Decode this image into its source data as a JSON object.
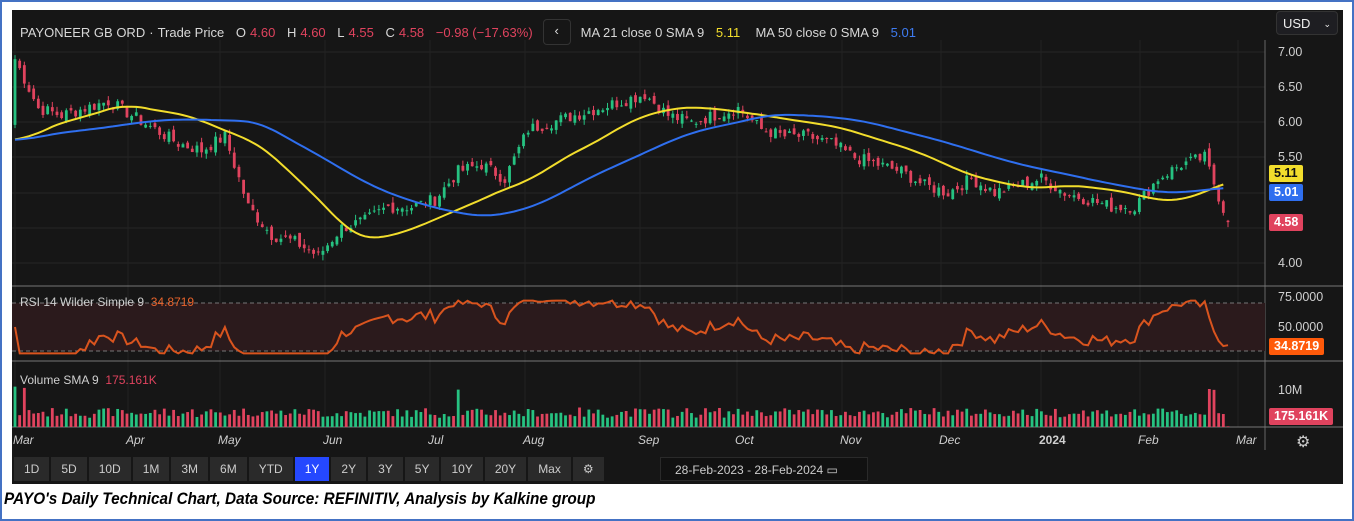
{
  "header": {
    "symbol": "PAYONEER GB ORD",
    "sep": "·",
    "price_type": "Trade Price",
    "o_label": "O",
    "o": "4.60",
    "h_label": "H",
    "h": "4.60",
    "l_label": "L",
    "l": "4.55",
    "c_label": "C",
    "c": "4.58",
    "change": "−0.98 (−17.63%)",
    "back": "‹",
    "ma21_label": "MA 21 close 0 SMA 9",
    "ma21": "5.11",
    "ma50_label": "MA 50 close 0 SMA 9",
    "ma50": "5.01"
  },
  "currency": "USD",
  "price_axis": [
    "7.00",
    "6.50",
    "6.00",
    "5.50",
    "4.00"
  ],
  "price_tags": {
    "ma21": "5.11",
    "ma50": "5.01",
    "last": "4.58"
  },
  "rsi": {
    "label": "RSI 14 Wilder Simple 9",
    "value": "34.8719",
    "axis": [
      "75.0000",
      "50.0000"
    ]
  },
  "volume": {
    "label": "Volume SMA 9",
    "value": "175.161K",
    "axis": [
      "10M"
    ]
  },
  "time_axis": [
    "Mar",
    "Apr",
    "May",
    "Jun",
    "Jul",
    "Aug",
    "Sep",
    "Oct",
    "Nov",
    "Dec",
    "2024",
    "Feb",
    "Mar"
  ],
  "ranges": [
    "1D",
    "5D",
    "10D",
    "1M",
    "3M",
    "6M",
    "YTD",
    "1Y",
    "2Y",
    "3Y",
    "5Y",
    "10Y",
    "20Y",
    "Max"
  ],
  "active_range": "1Y",
  "date_range": {
    "from": "28-Feb-2023",
    "sep": "-",
    "to": "28-Feb-2024"
  },
  "caption": "PAYO's Daily Technical Chart, Data Source: REFINITIV, Analysis by Kalkine group",
  "colors": {
    "up": "#26c281",
    "down": "#e0435e",
    "ma21": "#f2dd2c",
    "ma50": "#2f6fef",
    "rsi": "#d9541e"
  },
  "chart_data": {
    "type": "candlestick",
    "title": "PAYONEER GB ORD - Trade Price (daily, 1Y)",
    "x_range": [
      "2023-02-28",
      "2024-02-28"
    ],
    "ylim": [
      3.7,
      7.2
    ],
    "weekly_closes": [
      6.9,
      6.2,
      6.1,
      6.2,
      6.3,
      6.1,
      5.9,
      5.7,
      5.6,
      5.8,
      4.8,
      4.4,
      4.3,
      4.1,
      4.5,
      4.6,
      4.8,
      4.8,
      4.9,
      5.3,
      5.4,
      5.2,
      5.9,
      6.0,
      6.1,
      6.2,
      6.3,
      6.4,
      6.1,
      6.0,
      6.1,
      6.2,
      5.9,
      5.8,
      5.8,
      5.7,
      5.5,
      5.4,
      5.3,
      5.1,
      5.0,
      5.2,
      5.0,
      5.1,
      5.2,
      5.0,
      4.9,
      4.8,
      4.8,
      5.2,
      5.4,
      5.5,
      4.58
    ],
    "series": [
      {
        "name": "MA 21 close 0 SMA 9",
        "last": 5.11
      },
      {
        "name": "MA 50 close 0 SMA 9",
        "last": 5.01
      },
      {
        "name": "RSI 14",
        "last": 34.8719,
        "ylim": [
          20,
          80
        ]
      },
      {
        "name": "Volume",
        "last": 175161,
        "ylim": [
          0,
          15000000
        ]
      }
    ]
  }
}
